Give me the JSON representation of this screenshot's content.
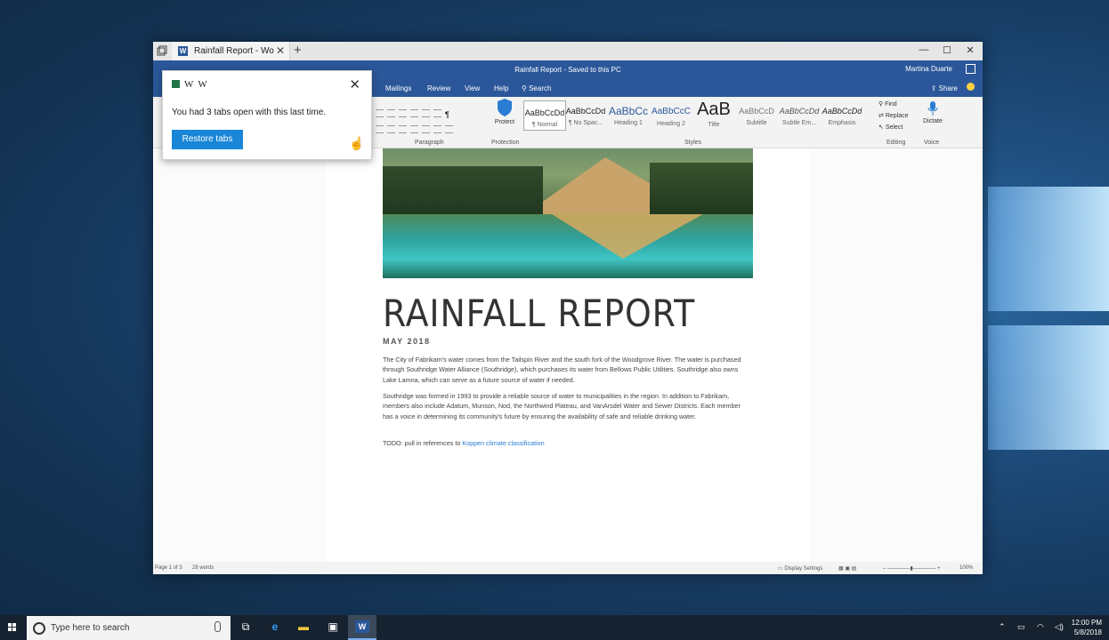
{
  "tab": {
    "title": "Rainfall Report - Wo",
    "new_tab": "+",
    "close": "✕"
  },
  "window_controls": {
    "minimize": "—",
    "maximize": "☐",
    "close": "✕"
  },
  "titlebar": {
    "doc_title": "Rainfall Report - Saved to this PC",
    "user": "Martina Duarte"
  },
  "menu": {
    "items": [
      "Mailings",
      "Review",
      "View",
      "Help"
    ],
    "search": "Search",
    "share": "Share"
  },
  "ribbon": {
    "groups": {
      "paragraph": "Paragraph",
      "protection": "Protection",
      "styles": "Styles",
      "editing": "Editing",
      "voice": "Voice"
    },
    "protect_label": "Protect",
    "styles": [
      {
        "sample": "AaBbCcDd",
        "name": "¶ Normal"
      },
      {
        "sample": "AaBbCcDd",
        "name": "¶ No Spac..."
      },
      {
        "sample": "AaBbCc",
        "name": "Heading 1"
      },
      {
        "sample": "AaBbCcC",
        "name": "Heading 2"
      },
      {
        "sample": "AaB",
        "name": "Title"
      },
      {
        "sample": "AaBbCcD",
        "name": "Subtitle"
      },
      {
        "sample": "AaBbCcDd",
        "name": "Subtle Em..."
      },
      {
        "sample": "AaBbCcDd",
        "name": "Emphasis"
      }
    ],
    "editing": {
      "find": "Find",
      "replace": "Replace",
      "select": "Select"
    },
    "dictate": "Dictate"
  },
  "popup": {
    "icons": [
      "excel-icon",
      "W",
      "W"
    ],
    "message": "You had 3 tabs open with this last time.",
    "restore_button": "Restore tabs",
    "close": "✕"
  },
  "document": {
    "heading": "RAINFALL REPORT",
    "date": "MAY 2018",
    "paragraph1": "The City of Fabrikam's water comes from the Tailspin River and the south fork of the Woodgrove River. The water is purchased through Southridge Water Alliance (Southridge), which purchases its water from Bellows Public Utilities. Southridge also owns Lake Lamna, which can serve as a future source of water if needed.",
    "paragraph2": "Southridge was formed in 1993 to provide a reliable source of water to municipalities in the region. In addition to Fabrikam, members also include Adatum, Munson, Nod, the Northwind Plateau, and VanArsdel Water and Sewer Districts. Each member has a voice in determining its community's future by ensuring the availability of safe and reliable drinking water.",
    "todo_prefix": "TODO: pull in references to ",
    "todo_link": "Koppen climate classification"
  },
  "statusbar": {
    "page": "Page 1 of 3",
    "words": "28 words",
    "display_settings": "Display Settings",
    "zoom": "100%"
  },
  "taskbar": {
    "search_placeholder": "Type here to search",
    "time": "12:00 PM",
    "date": "5/8/2018"
  },
  "colors": {
    "word_blue": "#2b579a",
    "restore_button": "#1a86d8",
    "taskbar": "#16222f"
  }
}
